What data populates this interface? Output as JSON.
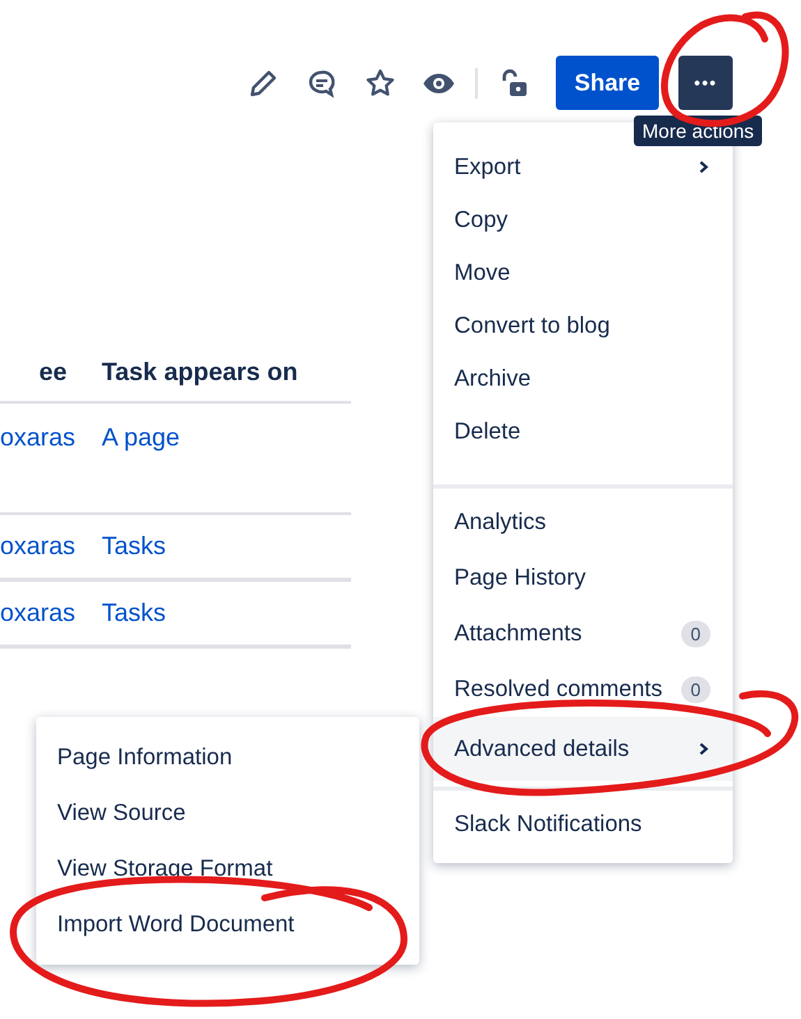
{
  "toolbar": {
    "share_button": "Share",
    "more_button": "•••",
    "tooltip": "More actions"
  },
  "table": {
    "columns": [
      "ee",
      "Task appears on"
    ],
    "rows": [
      {
        "cells": [
          "oxaras",
          "A page"
        ],
        "tall": true
      },
      {
        "cells": [
          "oxaras",
          "Tasks"
        ],
        "tall": false
      },
      {
        "cells": [
          "oxaras",
          "Tasks"
        ],
        "tall": false
      }
    ]
  },
  "menu": {
    "sections": [
      [
        {
          "label": "Export",
          "kind": "submenu",
          "selected": false
        },
        {
          "label": "Copy",
          "kind": "item",
          "selected": false
        },
        {
          "label": "Move",
          "kind": "item",
          "selected": false
        },
        {
          "label": "Convert to blog",
          "kind": "item",
          "selected": false
        },
        {
          "label": "Archive",
          "kind": "item",
          "selected": false
        },
        {
          "label": "Delete",
          "kind": "item",
          "selected": false
        }
      ],
      [
        {
          "label": "Analytics",
          "kind": "item",
          "selected": false
        },
        {
          "label": "Page History",
          "kind": "item",
          "selected": false
        },
        {
          "label": "Attachments",
          "kind": "badge",
          "badge": "0",
          "selected": false
        },
        {
          "label": "Resolved comments",
          "kind": "badge",
          "badge": "0",
          "selected": false
        },
        {
          "label": "Advanced details",
          "kind": "submenu",
          "selected": true
        }
      ],
      [
        {
          "label": "Slack Notifications",
          "kind": "item",
          "selected": false
        }
      ]
    ]
  },
  "submenu": {
    "items": [
      "Page Information",
      "View Source",
      "View Storage Format",
      "Import Word Document"
    ]
  }
}
